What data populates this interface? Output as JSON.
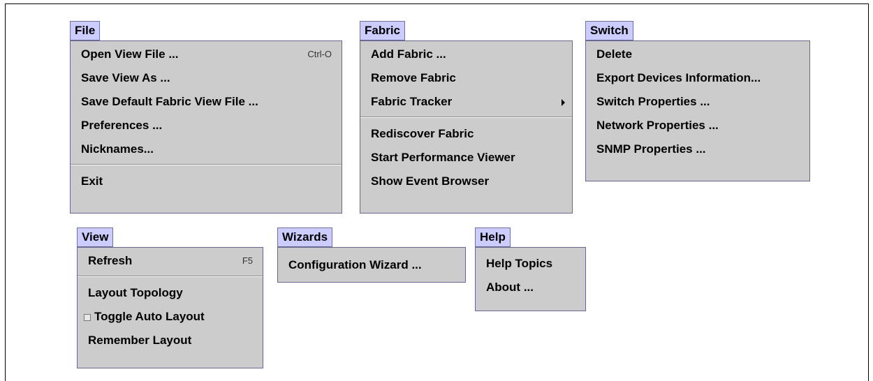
{
  "menus": {
    "file": {
      "title": "File",
      "items": [
        {
          "label": "Open View File ...",
          "accel": "Ctrl-O"
        },
        {
          "label": "Save View As ..."
        },
        {
          "label": "Save Default Fabric View File ..."
        },
        {
          "label": "Preferences ..."
        },
        {
          "label": "Nicknames..."
        },
        {
          "label": "Exit"
        }
      ]
    },
    "fabric": {
      "title": "Fabric",
      "items": [
        {
          "label": "Add Fabric ..."
        },
        {
          "label": "Remove Fabric"
        },
        {
          "label": "Fabric Tracker"
        },
        {
          "label": "Rediscover Fabric"
        },
        {
          "label": "Start Performance Viewer"
        },
        {
          "label": "Show Event Browser"
        }
      ]
    },
    "switch": {
      "title": "Switch",
      "items": [
        {
          "label": "Delete"
        },
        {
          "label": "Export Devices Information..."
        },
        {
          "label": "Switch Properties ..."
        },
        {
          "label": "Network Properties ..."
        },
        {
          "label": "SNMP Properties ..."
        }
      ]
    },
    "view": {
      "title": "View",
      "items": [
        {
          "label": "Refresh",
          "accel": "F5"
        },
        {
          "label": "Layout Topology"
        },
        {
          "label": "Toggle Auto Layout",
          "checked": false
        },
        {
          "label": "Remember Layout"
        }
      ]
    },
    "wizards": {
      "title": "Wizards",
      "items": [
        {
          "label": "Configuration Wizard ..."
        }
      ]
    },
    "help": {
      "title": "Help",
      "items": [
        {
          "label": "Help Topics"
        },
        {
          "label": "About ..."
        }
      ]
    }
  }
}
